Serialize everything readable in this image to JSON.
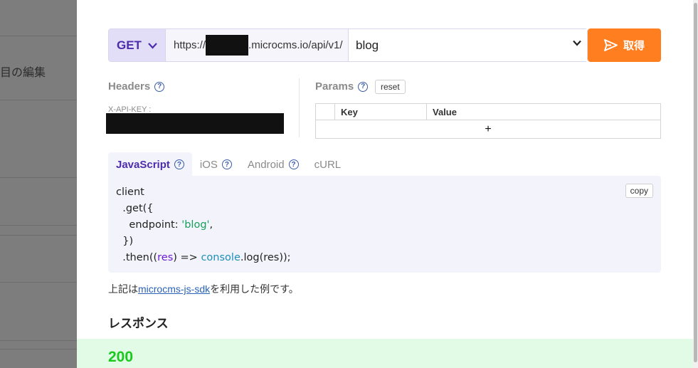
{
  "background": {
    "partial_label": "目の編集"
  },
  "request": {
    "method": "GET",
    "url_prefix": "https://",
    "url_suffix": ".microcms.io/api/v1/",
    "endpoint": "blog",
    "fetch_label": "取得"
  },
  "headers": {
    "title": "Headers",
    "key_label": "X-API-KEY :"
  },
  "params": {
    "title": "Params",
    "reset_label": "reset",
    "columns": [
      "Key",
      "Value"
    ],
    "add_symbol": "+"
  },
  "tabs": [
    {
      "label": "JavaScript",
      "active": true,
      "has_help": true
    },
    {
      "label": "iOS",
      "active": false,
      "has_help": true
    },
    {
      "label": "Android",
      "active": false,
      "has_help": true
    },
    {
      "label": "cURL",
      "active": false,
      "has_help": false
    }
  ],
  "code": {
    "copy_label": "copy",
    "line1": "client",
    "line2": "  .get({",
    "line3_key": "    endpoint: ",
    "line3_val": "'blog'",
    "line3_end": ",",
    "line4": "  })",
    "line5_a": "  .then((",
    "line5_res": "res",
    "line5_b": ") => ",
    "line5_console": "console",
    "line5_c": ".log(res));"
  },
  "note": {
    "before": "上記は",
    "link": "microcms-js-sdk",
    "after": "を利用した例です。"
  },
  "response": {
    "title": "レスポンス",
    "status": "200"
  },
  "colors": {
    "accent": "#4c2cad",
    "fetch_button": "#ff7e1f",
    "status_ok": "#19c91c",
    "string": "#15a05a"
  }
}
